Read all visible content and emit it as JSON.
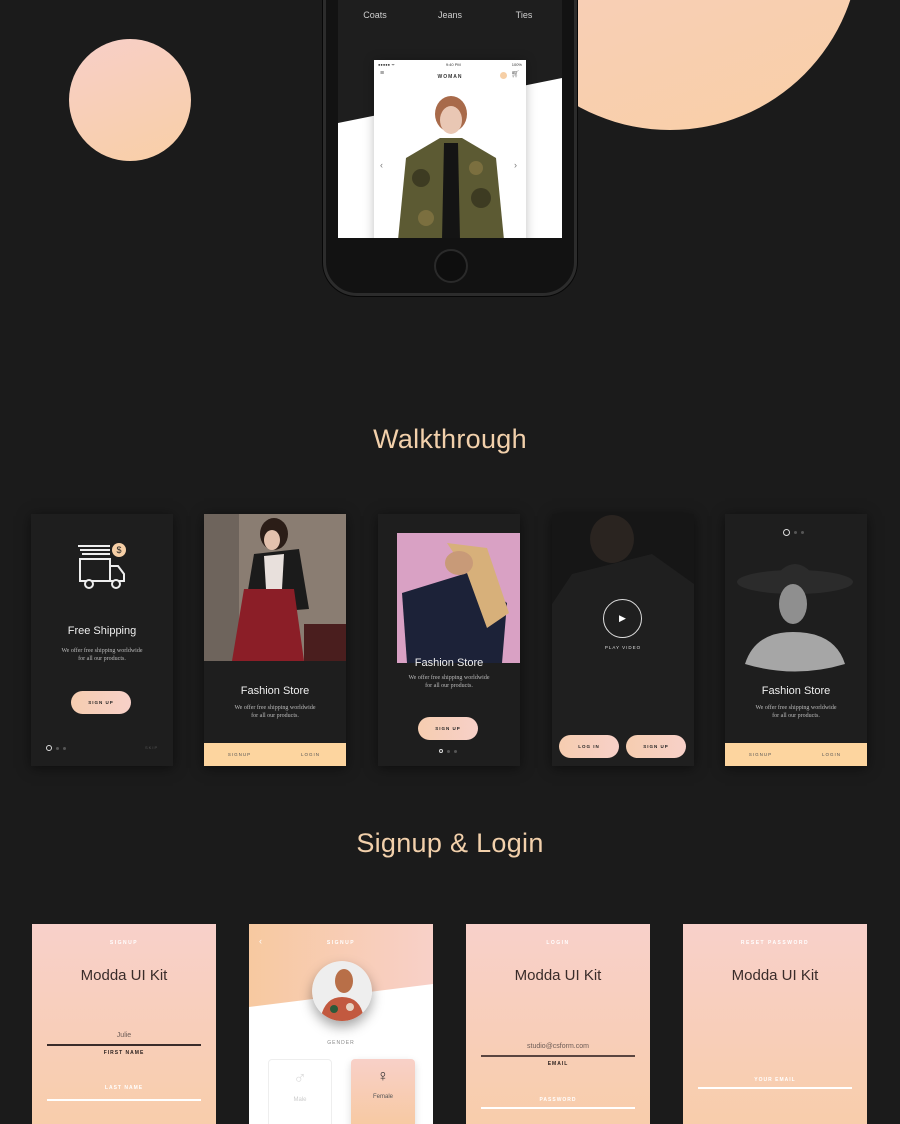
{
  "colors": {
    "background": "#1b1b1b",
    "accent": "#f2d0ab",
    "peach_start": "#f7cfc8",
    "peach_end": "#f9cfa6",
    "button_bar": "#fdd59f"
  },
  "hero": {
    "tabs": [
      "Coats",
      "Jeans",
      "Ties"
    ],
    "phone": {
      "status_carrier": "●●●●● ᯤ",
      "status_time": "9:40 PM",
      "status_battery": "100%",
      "title": "WOMAN",
      "menu_icon": "hamburger-icon",
      "cart_icon": "cart-icon",
      "prev": "‹",
      "next": "›"
    }
  },
  "walkthrough": {
    "heading": "Walkthrough",
    "card1": {
      "title": "Free Shipping",
      "subtitle1": "We offer free shipping worldwide",
      "subtitle2": "for all our products.",
      "button": "SIGN UP",
      "skip": "SKIP",
      "icon": "truck-dollar-icon"
    },
    "card2": {
      "title": "Fashion Store",
      "subtitle1": "We offer free shipping worldwide",
      "subtitle2": "for all our products.",
      "signup": "SIGNUP",
      "login": "LOGIN"
    },
    "card3": {
      "title": "Fashion Store",
      "subtitle1": "We offer free shipping worldwide",
      "subtitle2": "for all our products.",
      "button": "SIGN UP"
    },
    "card4": {
      "play": "PLAY VIDEO",
      "login": "LOG IN",
      "signup": "SIGN UP"
    },
    "card5": {
      "title": "Fashion Store",
      "subtitle1": "We offer free shipping worldwide",
      "subtitle2": "for all our products.",
      "signup": "SIGNUP",
      "login": "LOGIN"
    }
  },
  "signup_login": {
    "heading": "Signup & Login",
    "signup": {
      "header": "SIGNUP",
      "kit": "Modda UI Kit",
      "first_name_value": "Julie",
      "first_name_label": "FIRST NAME",
      "last_name_label": "LAST NAME"
    },
    "gender": {
      "header": "SIGNUP",
      "back": "‹",
      "gender_label": "GENDER",
      "male": "Male",
      "female": "Female",
      "male_symbol": "♂",
      "female_symbol": "♀"
    },
    "login": {
      "header": "LOGIN",
      "kit": "Modda UI Kit",
      "email_value": "studio@csform.com",
      "email_label": "EMAIL",
      "password_label": "PASSWORD"
    },
    "reset": {
      "header": "RESET PASSWORD",
      "kit": "Modda UI Kit",
      "email_label": "YOUR EMAIL"
    }
  }
}
